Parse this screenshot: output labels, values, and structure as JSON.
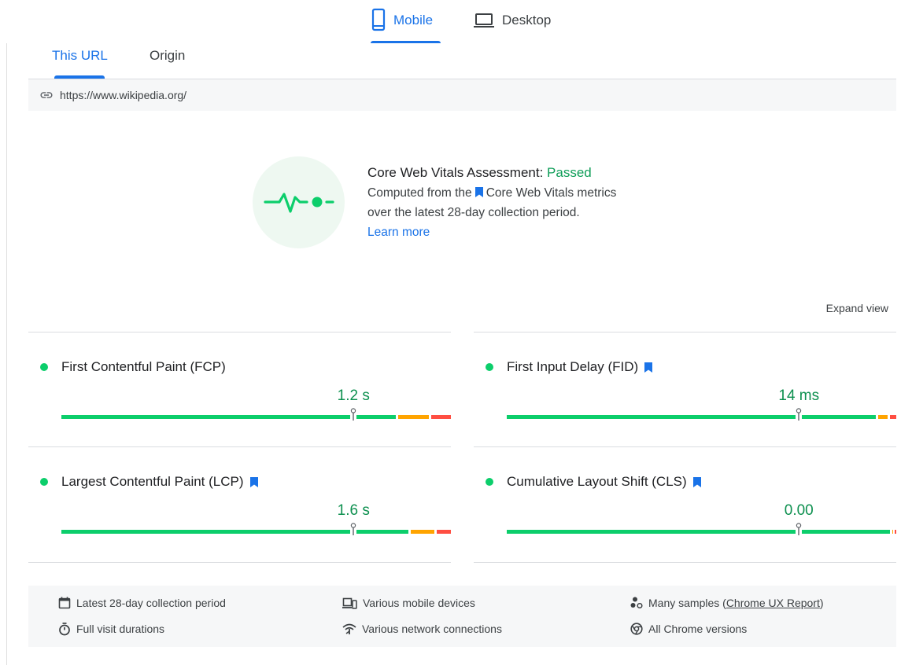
{
  "device_tabs": {
    "mobile": "Mobile",
    "desktop": "Desktop",
    "selected": "mobile"
  },
  "scope_tabs": {
    "this_url": "This URL",
    "origin": "Origin",
    "selected": "this_url"
  },
  "url": "https://www.wikipedia.org/",
  "assessment": {
    "title_prefix": "Core Web Vitals Assessment: ",
    "status": "Passed",
    "line1_prefix": "Computed from the",
    "line1_suffix": "Core Web Vitals metrics",
    "line2": "over the latest 28-day collection period.",
    "learn_more": "Learn more"
  },
  "expand_view": "Expand view",
  "colors": {
    "good": "#0cce6b",
    "needs_improvement": "#ffa400",
    "poor": "#ff4e42",
    "accent": "#1a73e8",
    "value": "#0d904f"
  },
  "metrics": [
    {
      "name": "First Contentful Paint (FCP)",
      "value": "1.2 s",
      "core": false,
      "status": "good",
      "distribution": {
        "good": 0.865,
        "needs_improvement": 0.085,
        "poor": 0.05
      },
      "marker": 0.75
    },
    {
      "name": "First Input Delay (FID)",
      "value": "14 ms",
      "core": true,
      "status": "good",
      "distribution": {
        "good": 0.954,
        "needs_improvement": 0.03,
        "poor": 0.016
      },
      "marker": 0.75
    },
    {
      "name": "Largest Contentful Paint (LCP)",
      "value": "1.6 s",
      "core": true,
      "status": "good",
      "distribution": {
        "good": 0.896,
        "needs_improvement": 0.068,
        "poor": 0.036
      },
      "marker": 0.75
    },
    {
      "name": "Cumulative Layout Shift (CLS)",
      "value": "0.00",
      "core": true,
      "status": "good",
      "distribution": {
        "good": 0.99,
        "needs_improvement": 0.006,
        "poor": 0.004
      },
      "marker": 0.75
    }
  ],
  "footer": {
    "collection_period": "Latest 28-day collection period",
    "visit_durations": "Full visit durations",
    "devices": "Various mobile devices",
    "network": "Various network connections",
    "samples_prefix": "Many samples (",
    "samples_link": "Chrome UX Report",
    "samples_suffix": ")",
    "chrome_versions": "All Chrome versions"
  }
}
